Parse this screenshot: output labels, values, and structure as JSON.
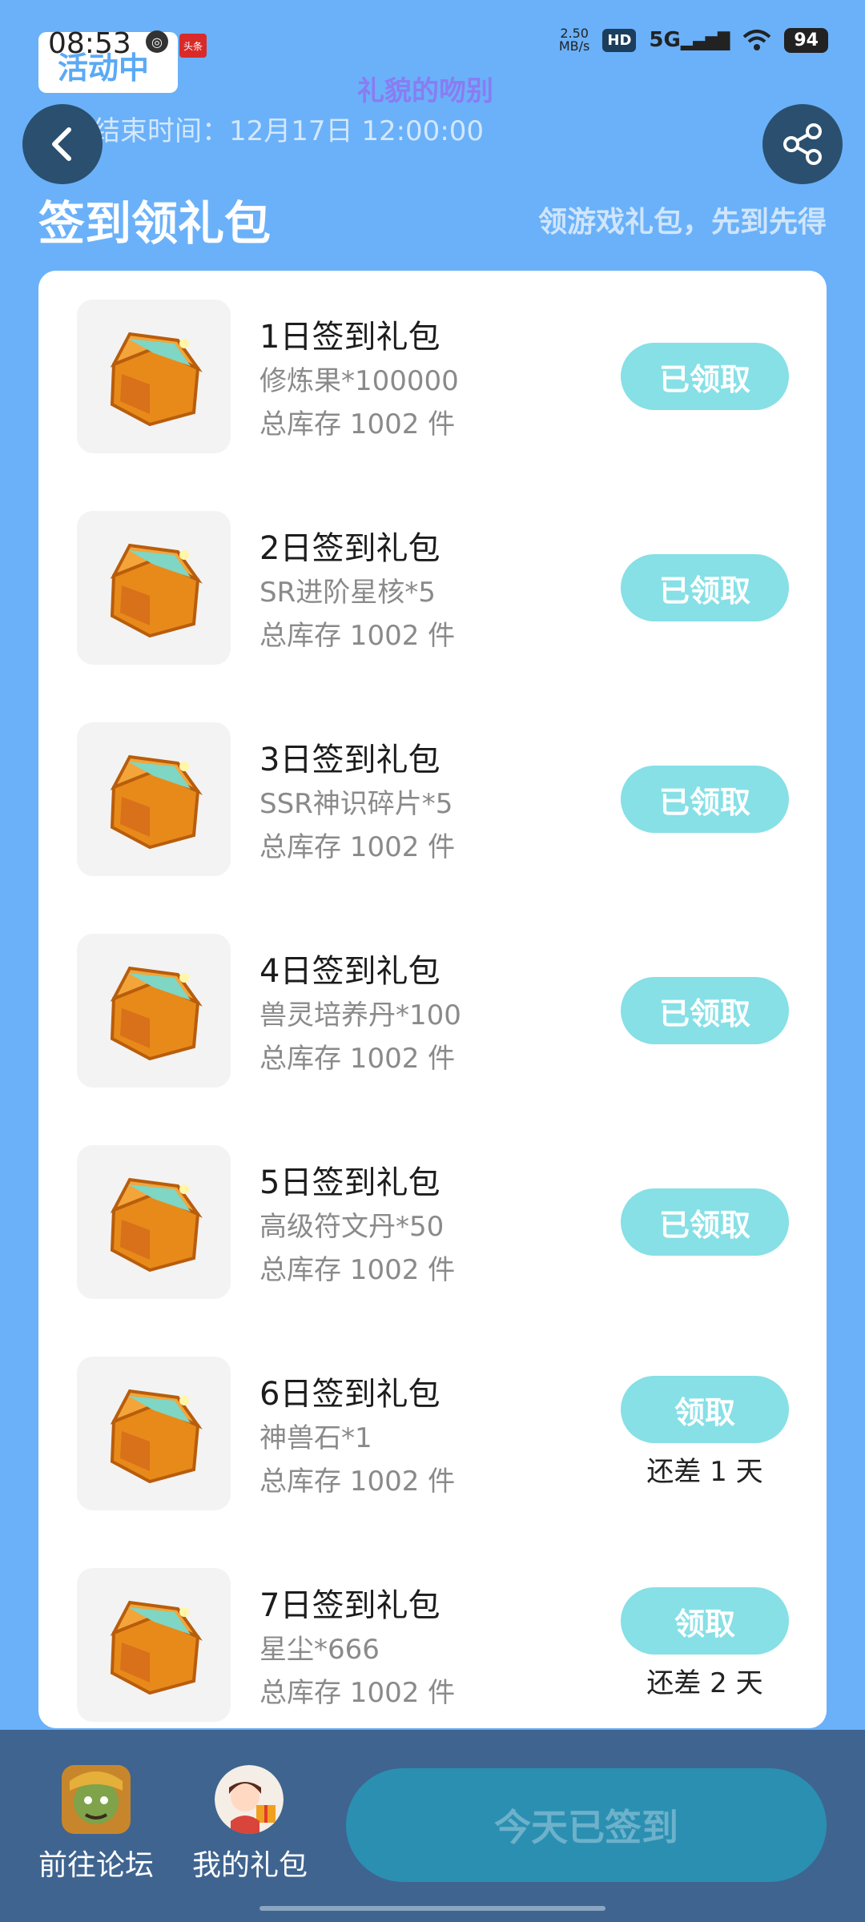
{
  "status_bar": {
    "time": "08:53",
    "net_speed_value": "2.50",
    "net_speed_unit": "MB/s",
    "hd": "HD",
    "signal": "5G",
    "battery": "94",
    "small_badge": "头条"
  },
  "header": {
    "status_pill": "活动中",
    "activity_name": "礼貌的吻别",
    "end_time": "活动结束时间：12月17日 12:00:00",
    "section_title": "签到领礼包",
    "section_hint": "领游戏礼包，先到先得"
  },
  "gifts": [
    {
      "title": "1日签到礼包",
      "item": "修炼果*100000",
      "stock": "总库存 1002 件",
      "button": "已领取",
      "remain": ""
    },
    {
      "title": "2日签到礼包",
      "item": "SR进阶星核*5",
      "stock": "总库存 1002 件",
      "button": "已领取",
      "remain": ""
    },
    {
      "title": "3日签到礼包",
      "item": "SSR神识碎片*5",
      "stock": "总库存 1002 件",
      "button": "已领取",
      "remain": ""
    },
    {
      "title": "4日签到礼包",
      "item": "兽灵培养丹*100",
      "stock": "总库存 1002 件",
      "button": "已领取",
      "remain": ""
    },
    {
      "title": "5日签到礼包",
      "item": "高级符文丹*50",
      "stock": "总库存 1002 件",
      "button": "已领取",
      "remain": ""
    },
    {
      "title": "6日签到礼包",
      "item": "神兽石*1",
      "stock": "总库存 1002 件",
      "button": "领取",
      "remain": "还差 1 天"
    },
    {
      "title": "7日签到礼包",
      "item": "星尘*666",
      "stock": "总库存 1002 件",
      "button": "领取",
      "remain": "还差 2 天"
    }
  ],
  "bottom_bar": {
    "forum_label": "前往论坛",
    "my_gifts_label": "我的礼包",
    "signed_button": "今天已签到"
  },
  "icons": {
    "back": "chevron-left-icon",
    "share": "share-icon",
    "gift": "treasure-chest-icon"
  },
  "colors": {
    "background": "#6ab1f9",
    "claim_button": "#86e0e6",
    "bottom_bar": "#3f6490",
    "signed_button": "#2b8fb1"
  }
}
